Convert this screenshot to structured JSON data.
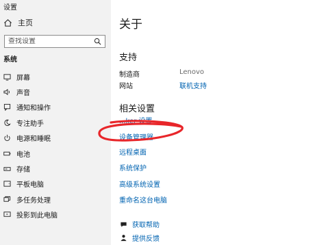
{
  "window": {
    "title": "设置"
  },
  "sidebar": {
    "home_label": "主页",
    "search_placeholder": "查找设置",
    "section_label": "系统",
    "items": [
      {
        "label": "屏幕",
        "icon": "display-icon"
      },
      {
        "label": "声音",
        "icon": "speaker-icon"
      },
      {
        "label": "通知和操作",
        "icon": "notification-icon"
      },
      {
        "label": "专注助手",
        "icon": "moon-icon"
      },
      {
        "label": "电源和睡眠",
        "icon": "power-icon"
      },
      {
        "label": "电池",
        "icon": "battery-icon"
      },
      {
        "label": "存储",
        "icon": "storage-icon"
      },
      {
        "label": "平板电脑",
        "icon": "tablet-icon"
      },
      {
        "label": "多任务处理",
        "icon": "multitask-icon"
      },
      {
        "label": "投影到此电脑",
        "icon": "project-icon"
      }
    ]
  },
  "main": {
    "title": "关于",
    "support": {
      "heading": "支持",
      "manufacturer_key": "制造商",
      "manufacturer_value": "Lenovo",
      "website_key": "网站",
      "website_value": "联机支持"
    },
    "related": {
      "heading": "相关设置",
      "partial_link": "...ker 设置",
      "links": [
        "设备管理器",
        "远程桌面",
        "系统保护",
        "高级系统设置",
        "重命名这台电脑"
      ]
    },
    "help": {
      "get_help": "获取帮助",
      "feedback": "提供反馈"
    }
  },
  "annotation": {
    "color": "#e8262a",
    "description": "red hand-drawn circle around 设备管理器"
  },
  "colors": {
    "link": "#0063b1",
    "sidebar_bg": "#f2f2f2"
  }
}
